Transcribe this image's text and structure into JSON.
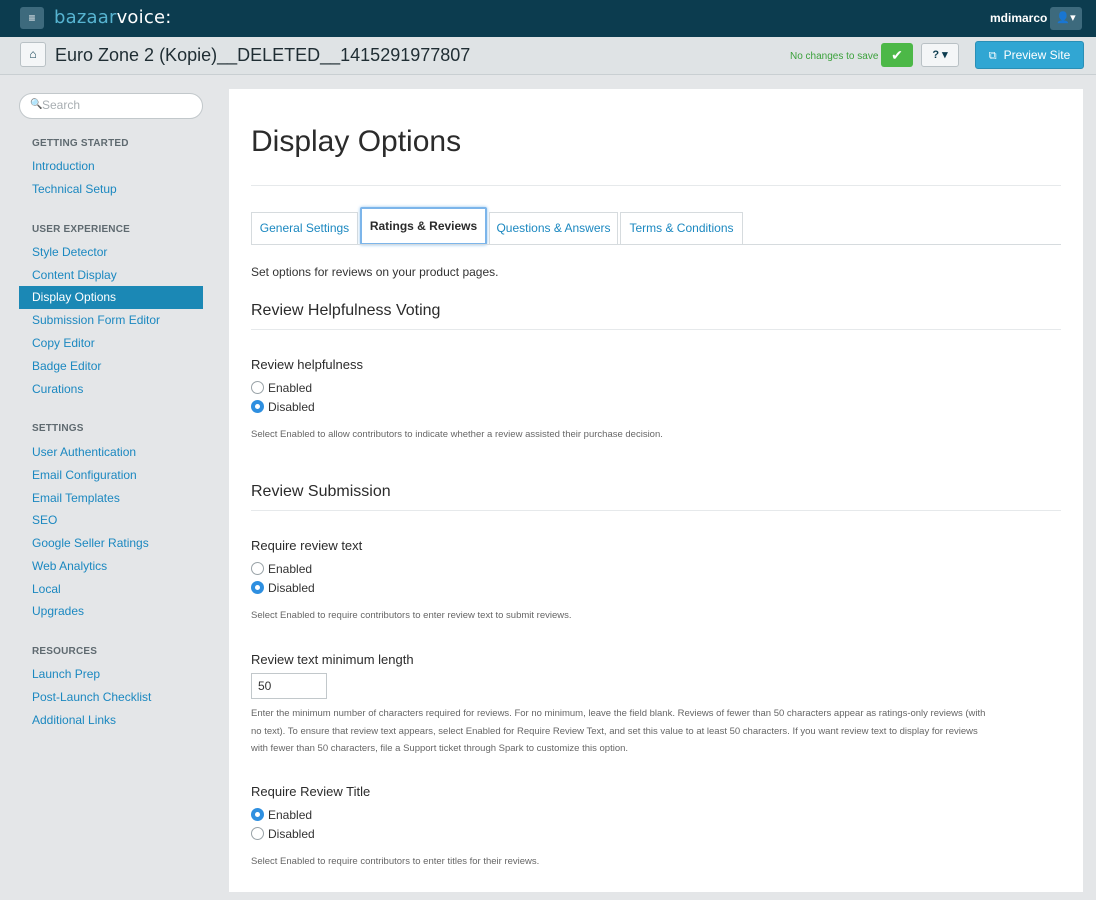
{
  "topbar": {
    "logo_part1": "bazaar",
    "logo_part2": "voice:",
    "username": "mdimarco",
    "menu_icon": "≡",
    "user_icon": "👤▾"
  },
  "subheader": {
    "site_title": "Euro Zone 2 (Kopie)__DELETED__1415291977807",
    "save_status": "No changes to save",
    "preview_label": "Preview Site"
  },
  "search": {
    "placeholder": "Search"
  },
  "sidebar": {
    "sections": [
      {
        "title": "GETTING STARTED",
        "items": [
          "Introduction",
          "Technical Setup"
        ]
      },
      {
        "title": "USER EXPERIENCE",
        "items": [
          "Style Detector",
          "Content Display",
          "Display Options",
          "Submission Form Editor",
          "Copy Editor",
          "Badge Editor",
          "Curations"
        ]
      },
      {
        "title": "SETTINGS",
        "items": [
          "User Authentication",
          "Email Configuration",
          "Email Templates",
          "SEO",
          "Google Seller Ratings",
          "Web Analytics",
          "Local",
          "Upgrades"
        ]
      },
      {
        "title": "RESOURCES",
        "items": [
          "Launch Prep",
          "Post-Launch Checklist",
          "Additional Links"
        ]
      }
    ],
    "active_item": "Display Options"
  },
  "main": {
    "title": "Display Options",
    "tabs": [
      "General Settings",
      "Ratings & Reviews",
      "Questions & Answers",
      "Terms & Conditions"
    ],
    "active_tab": "Ratings & Reviews",
    "intro": "Set options for reviews on your product pages.",
    "sections": {
      "helpfulness_title": "Review Helpfulness Voting",
      "submission_title": "Review Submission"
    },
    "fields": {
      "helpfulness": {
        "label": "Review helpfulness",
        "options": [
          "Enabled",
          "Disabled"
        ],
        "selected": "Disabled",
        "help": "Select Enabled to allow contributors to indicate whether a review assisted their purchase decision."
      },
      "require_text": {
        "label": "Require review text",
        "options": [
          "Enabled",
          "Disabled"
        ],
        "selected": "Disabled",
        "help": "Select Enabled to require contributors to enter review text to submit reviews."
      },
      "min_length": {
        "label": "Review text minimum length",
        "value": "50",
        "help": "Enter the minimum number of characters required for reviews. For no minimum, leave the field blank. Reviews of fewer than 50 characters appear as ratings-only reviews (with no text). To ensure that review text appears, select Enabled for Require Review Text, and set this value to at least 50 characters. If you want review text to display for reviews with fewer than 50 characters, file a Support ticket through Spark to customize this option."
      },
      "require_title": {
        "label": "Require Review Title",
        "options": [
          "Enabled",
          "Disabled"
        ],
        "selected": "Enabled",
        "help": "Select Enabled to require contributors to enter titles for their reviews."
      }
    }
  }
}
